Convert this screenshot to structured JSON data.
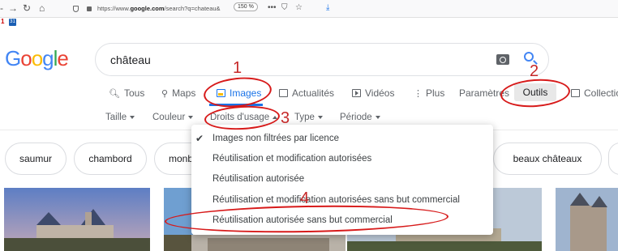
{
  "browser": {
    "url_prefix": "https://www.",
    "url_domain": "google.com",
    "url_rest": "/search?q=chateau&",
    "zoom": "150 %",
    "bookmark_number": "1",
    "bookmark_icon_text": "31"
  },
  "logo": {
    "g1": "G",
    "o1": "o",
    "o2": "o",
    "g2": "g",
    "l": "l",
    "e": "e"
  },
  "search": {
    "query": "château"
  },
  "tabs": [
    {
      "label": "Tous",
      "icon": "search-icon"
    },
    {
      "label": "Maps",
      "icon": "pin-icon"
    },
    {
      "label": "Images",
      "icon": "image-icon"
    },
    {
      "label": "Actualités",
      "icon": "news-icon"
    },
    {
      "label": "Vidéos",
      "icon": "play-icon"
    },
    {
      "label": "Plus",
      "icon": "more-icon"
    }
  ],
  "settings_label": "Paramètres",
  "tools_label": "Outils",
  "collections_label": "Collections",
  "filters": [
    "Taille",
    "Couleur",
    "Droits d'usage",
    "Type",
    "Période"
  ],
  "chips": [
    "saumur",
    "chambord",
    "monb",
    "beaux châteaux",
    ""
  ],
  "usage_menu": [
    {
      "label": "Images non filtrées par licence",
      "checked": true
    },
    {
      "label": "Réutilisation et modification autorisées",
      "checked": false
    },
    {
      "label": "Réutilisation autorisée",
      "checked": false
    },
    {
      "label": "Réutilisation et modification autorisées sans but commercial",
      "checked": false
    },
    {
      "label": "Réutilisation autorisée sans but commercial",
      "checked": false
    }
  ],
  "annotations": [
    "1",
    "2",
    "3",
    "4"
  ],
  "colors": {
    "accent": "#1a73e8",
    "annotation": "#d71a1a"
  }
}
